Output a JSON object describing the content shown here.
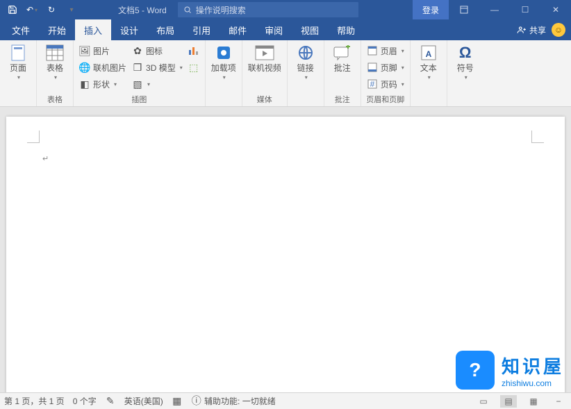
{
  "titlebar": {
    "doc_title": "文档5 - Word",
    "search_placeholder": "操作说明搜索",
    "login": "登录"
  },
  "tabs": {
    "file": "文件",
    "home": "开始",
    "insert": "插入",
    "design": "设计",
    "layout": "布局",
    "reference": "引用",
    "mail": "邮件",
    "review": "审阅",
    "view": "视图",
    "help": "帮助",
    "share": "共享"
  },
  "ribbon": {
    "pages": {
      "label": "页面",
      "cover": "页面"
    },
    "tables": {
      "label": "表格",
      "table": "表格"
    },
    "illus": {
      "label": "插图",
      "picture": "图片",
      "online_pic": "联机图片",
      "shapes": "形状",
      "icons": "图标",
      "model3d": "3D 模型",
      "chart": ""
    },
    "addins": {
      "label": "",
      "addin": "加载项"
    },
    "media": {
      "label": "媒体",
      "online_video": "联机视频"
    },
    "links": {
      "label": "",
      "link": "链接"
    },
    "comments": {
      "label": "批注",
      "comment": "批注"
    },
    "header_footer": {
      "label": "页眉和页脚",
      "header": "页眉",
      "footer": "页脚",
      "page_num": "页码"
    },
    "text": {
      "label": "",
      "text": "文本"
    },
    "symbols": {
      "label": "",
      "symbol": "符号"
    }
  },
  "status": {
    "page": "第 1 页，共 1 页",
    "words": "0 个字",
    "lang": "英语(美国)",
    "accessibility": "辅助功能: 一切就绪"
  },
  "watermark": {
    "title": "知识屋",
    "url": "zhishiwu.com"
  }
}
